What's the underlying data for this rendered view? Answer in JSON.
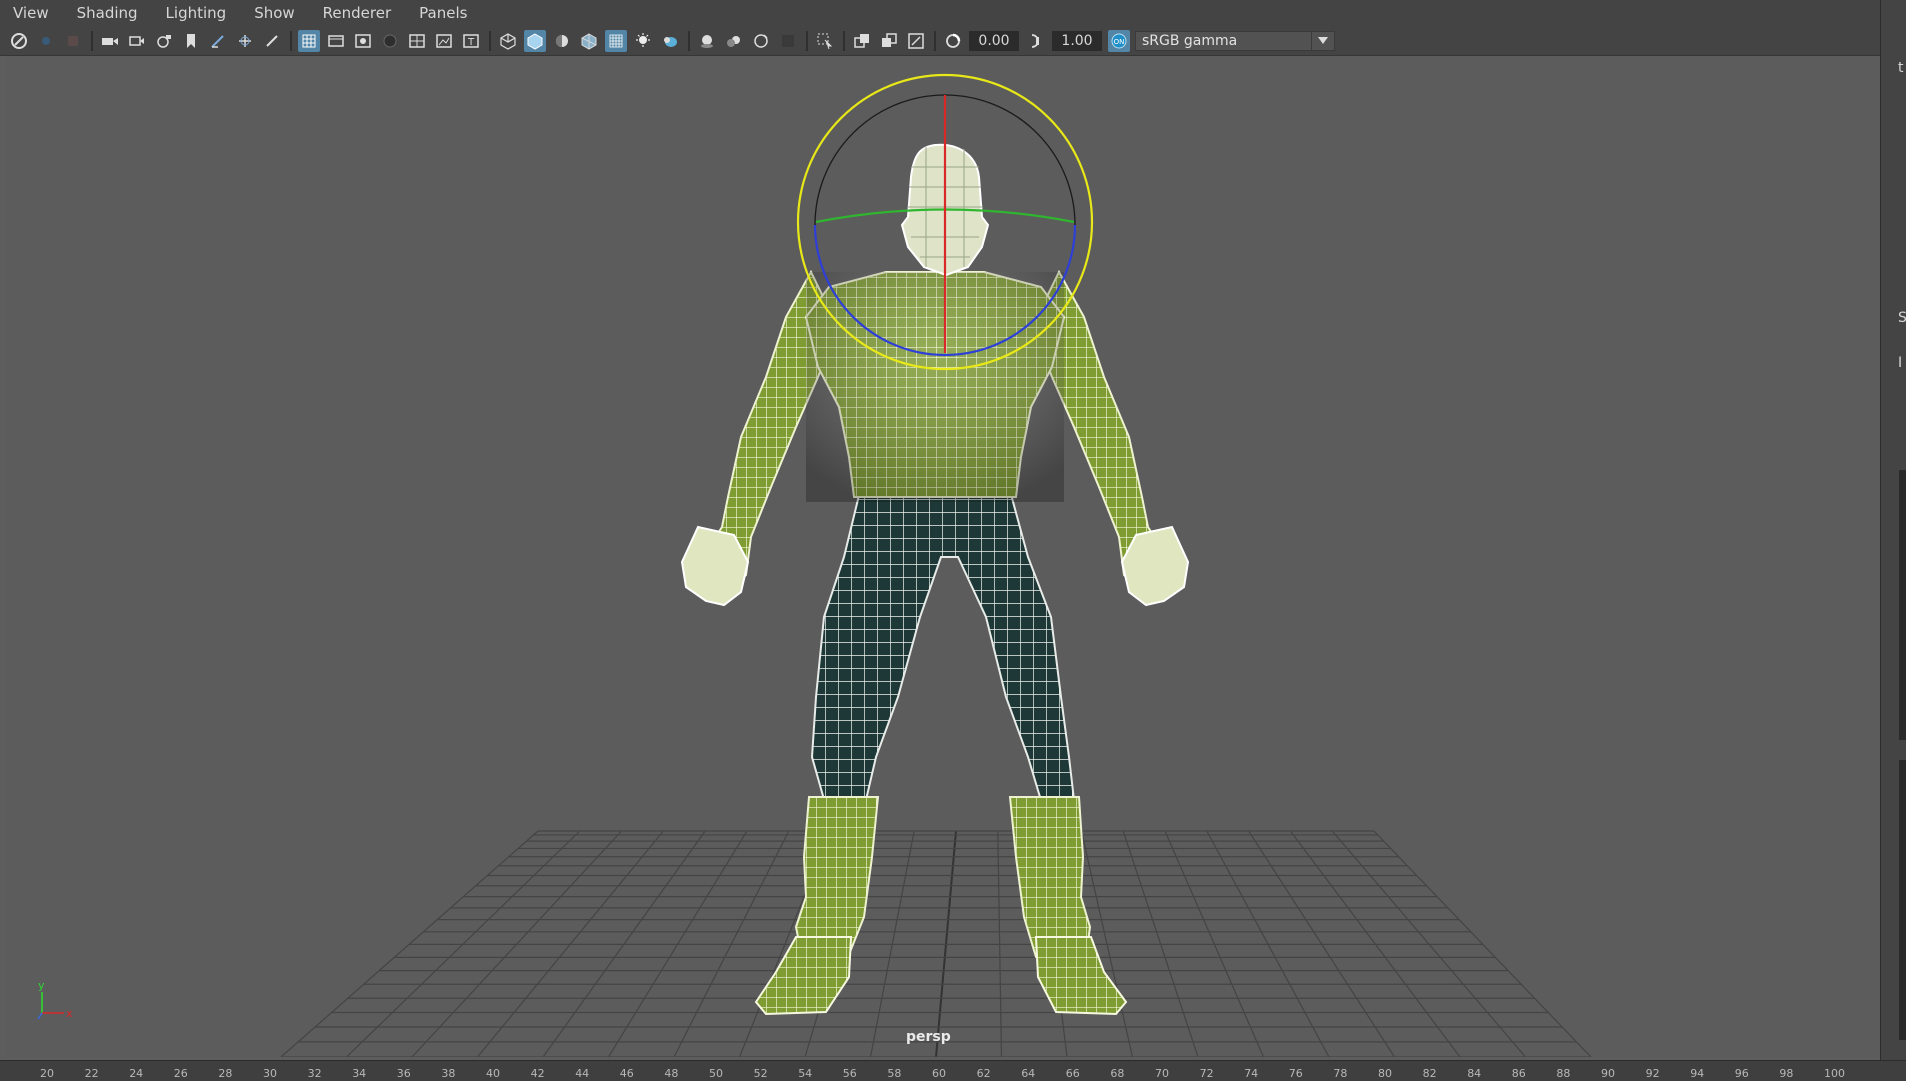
{
  "menubar": {
    "items": [
      "View",
      "Shading",
      "Lighting",
      "Show",
      "Renderer",
      "Panels"
    ]
  },
  "toolbar": {
    "exposure": "0.00",
    "gamma": "1.00",
    "color_space": "sRGB gamma",
    "icons": [
      "select-camera-icon",
      "camera-icon",
      "film-gate-icon",
      "bookmark-icon",
      "grid-icon",
      "wireframe-icon",
      "smooth-shade-icon",
      "lights-icon",
      "isolate-icon",
      "xray-icon",
      "exposure-icon",
      "gamma-icon",
      "color-management-icon"
    ]
  },
  "viewport": {
    "camera": "persp",
    "axis_y": "y",
    "axis_x": "x"
  },
  "right_panel": {
    "chars": [
      "t",
      "S",
      "I"
    ]
  },
  "timeline": {
    "ticks": [
      "20",
      "22",
      "24",
      "26",
      "28",
      "30",
      "32",
      "34",
      "36",
      "38",
      "40",
      "42",
      "44",
      "46",
      "48",
      "50",
      "52",
      "54",
      "56",
      "58",
      "60",
      "62",
      "64",
      "66",
      "68",
      "70",
      "72",
      "74",
      "76",
      "78",
      "80",
      "82",
      "84",
      "86",
      "88",
      "90",
      "92",
      "94",
      "96",
      "98",
      "100"
    ]
  },
  "colors": {
    "panel": "#444444",
    "viewport": "#5c5c5c",
    "accent": "#5285a6",
    "mesh_upper": "#8aa83a",
    "mesh_lower": "#1d3a3a",
    "manip_yellow": "#e8e818"
  }
}
